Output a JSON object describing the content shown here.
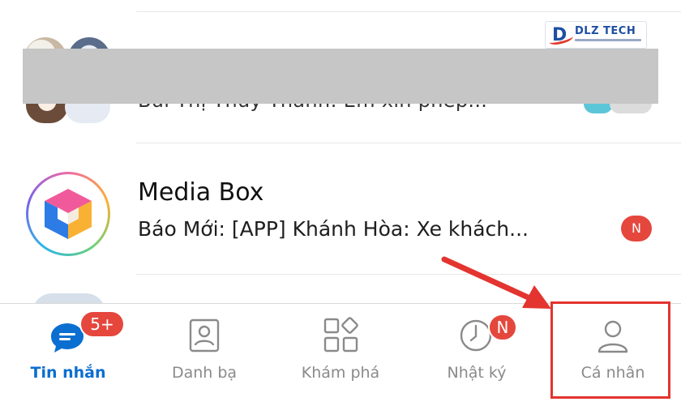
{
  "top_row": {
    "partial_text": "Bùi Thị Thúy Thanh: Em xin phép..."
  },
  "watermark": {
    "letter": "D",
    "brand": "DLZ TECH"
  },
  "conversation": {
    "title": "Media Box",
    "preview": "Báo Mới: [APP] Khánh Hòa: Xe khách...",
    "badge": "N"
  },
  "tabs": [
    {
      "label": "Tin nhắn",
      "icon": "chat-bubble-icon",
      "badge": "5+",
      "active": true
    },
    {
      "label": "Danh bạ",
      "icon": "contacts-icon",
      "active": false
    },
    {
      "label": "Khám phá",
      "icon": "discover-grid-icon",
      "active": false
    },
    {
      "label": "Nhật ký",
      "icon": "clock-icon",
      "badge": "N",
      "active": false
    },
    {
      "label": "Cá nhân",
      "icon": "person-icon",
      "active": false
    }
  ],
  "colors": {
    "accent": "#0b6ed1",
    "badge": "#e5473d",
    "annotation": "#e3342f",
    "redaction": "#c6c6c6"
  }
}
